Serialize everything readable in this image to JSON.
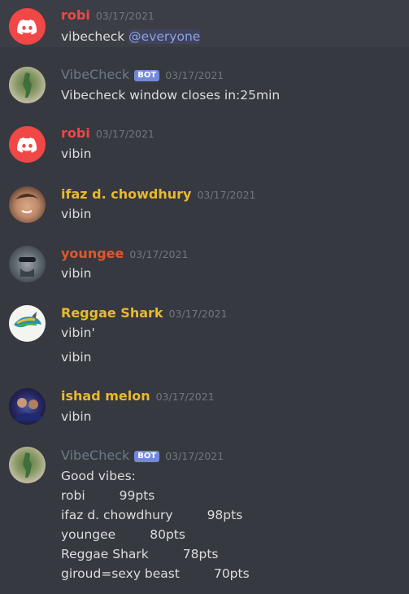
{
  "colors": {
    "robi": "#f04747",
    "vibecheck": "#6b7a8a",
    "ifaz": "#e9b92f",
    "youngee": "#e0582e",
    "reggae": "#e9b92f",
    "ishad": "#e9b92f",
    "mention": "#8ea1e1"
  },
  "messages": [
    {
      "author": "robi",
      "timestamp": "03/17/2021",
      "text_prefix": "vibecheck ",
      "mention": "@everyone"
    },
    {
      "author": "VibeCheck",
      "bot": "BOT",
      "timestamp": "03/17/2021",
      "text": "Vibecheck window closes in:25min"
    },
    {
      "author": "robi",
      "timestamp": "03/17/2021",
      "text": "vibin"
    },
    {
      "author": "ifaz d. chowdhury",
      "timestamp": "03/17/2021",
      "text": "vibin"
    },
    {
      "author": "youngee",
      "timestamp": "03/17/2021",
      "text": "vibin"
    },
    {
      "author": "Reggae Shark",
      "timestamp": "03/17/2021",
      "text": "vibin'",
      "text2": "vibin"
    },
    {
      "author": "ishad melon",
      "timestamp": "03/17/2021",
      "text": "vibin"
    },
    {
      "author": "VibeCheck",
      "bot": "BOT",
      "timestamp": "03/17/2021",
      "text": "Good vibes:",
      "scores": [
        {
          "name": "robi",
          "pts": "99pts"
        },
        {
          "name": "ifaz d. chowdhury",
          "pts": "98pts"
        },
        {
          "name": "youngee",
          "pts": "80pts"
        },
        {
          "name": "Reggae Shark",
          "pts": "78pts"
        },
        {
          "name": "giroud=sexy beast",
          "pts": "70pts"
        }
      ]
    }
  ]
}
